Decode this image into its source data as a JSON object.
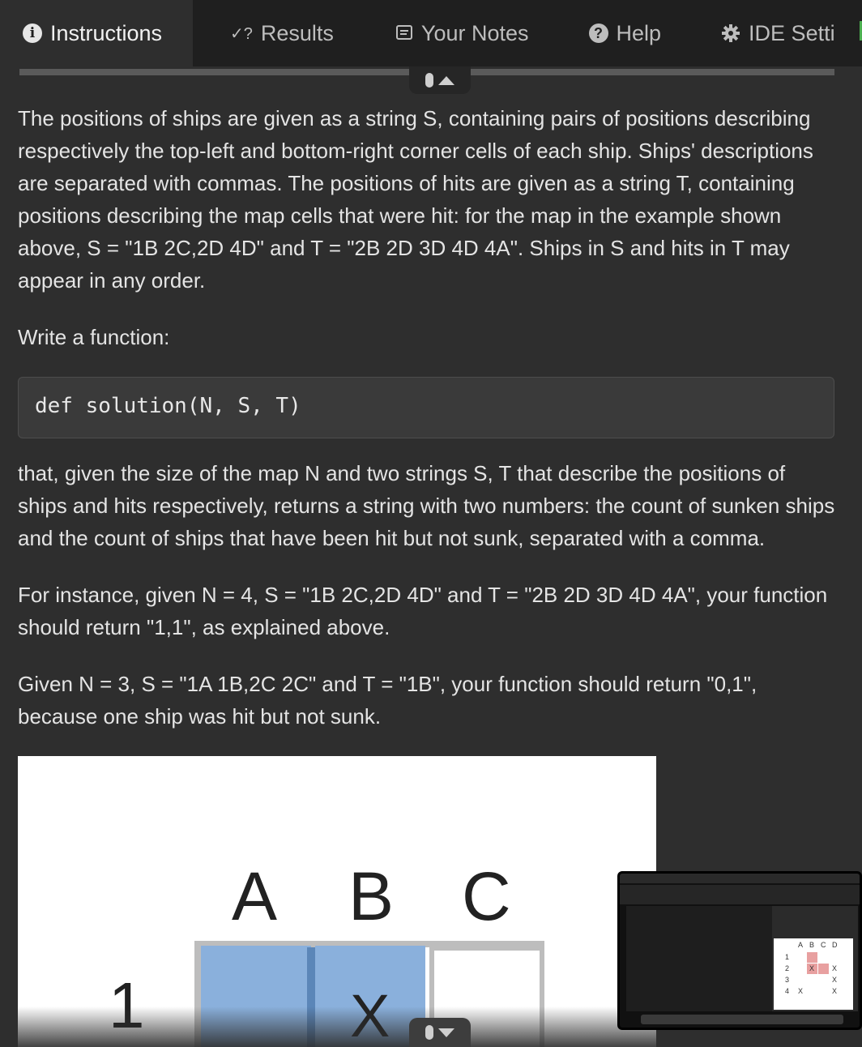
{
  "tabs": {
    "instructions": "Instructions",
    "results": "Results",
    "results_icon_glyph": "✓?",
    "notes": "Your Notes",
    "help": "Help",
    "ide": "IDE Setti"
  },
  "content": {
    "p1": "The positions of ships are given as a string S, containing pairs of positions describing respectively the top-left and bottom-right corner cells of each ship. Ships' descriptions are separated with commas. The positions of hits are given as a string T, containing positions describing the map cells that were hit: for the map in the example shown above, S = \"1B 2C,2D 4D\" and T = \"2B 2D 3D 4D 4A\". Ships in S and hits in T may appear in any order.",
    "p2": "Write a function:",
    "code": "def solution(N, S, T)",
    "p3": "that, given the size of the map N and two strings S, T that describe the positions of ships and hits respectively, returns a string with two numbers: the count of sunken ships and the count of ships that have been hit but not sunk, separated with a comma.",
    "p4": "For instance, given N = 4, S = \"1B 2C,2D 4D\" and T = \"2B 2D 3D 4D 4A\", your function should return \"1,1\", as explained above.",
    "p5": "Given N = 3, S = \"1A 1B,2C 2C\" and T = \"1B\", your function should return \"0,1\", because one ship was hit but not sunk."
  },
  "figure": {
    "columns": [
      "A",
      "B",
      "C"
    ],
    "row": "1",
    "hit_mark": "X"
  },
  "thumbnail": {
    "columns": [
      "A",
      "B",
      "C",
      "D"
    ],
    "rows": [
      "1",
      "2",
      "3",
      "4"
    ],
    "mark": "X"
  }
}
